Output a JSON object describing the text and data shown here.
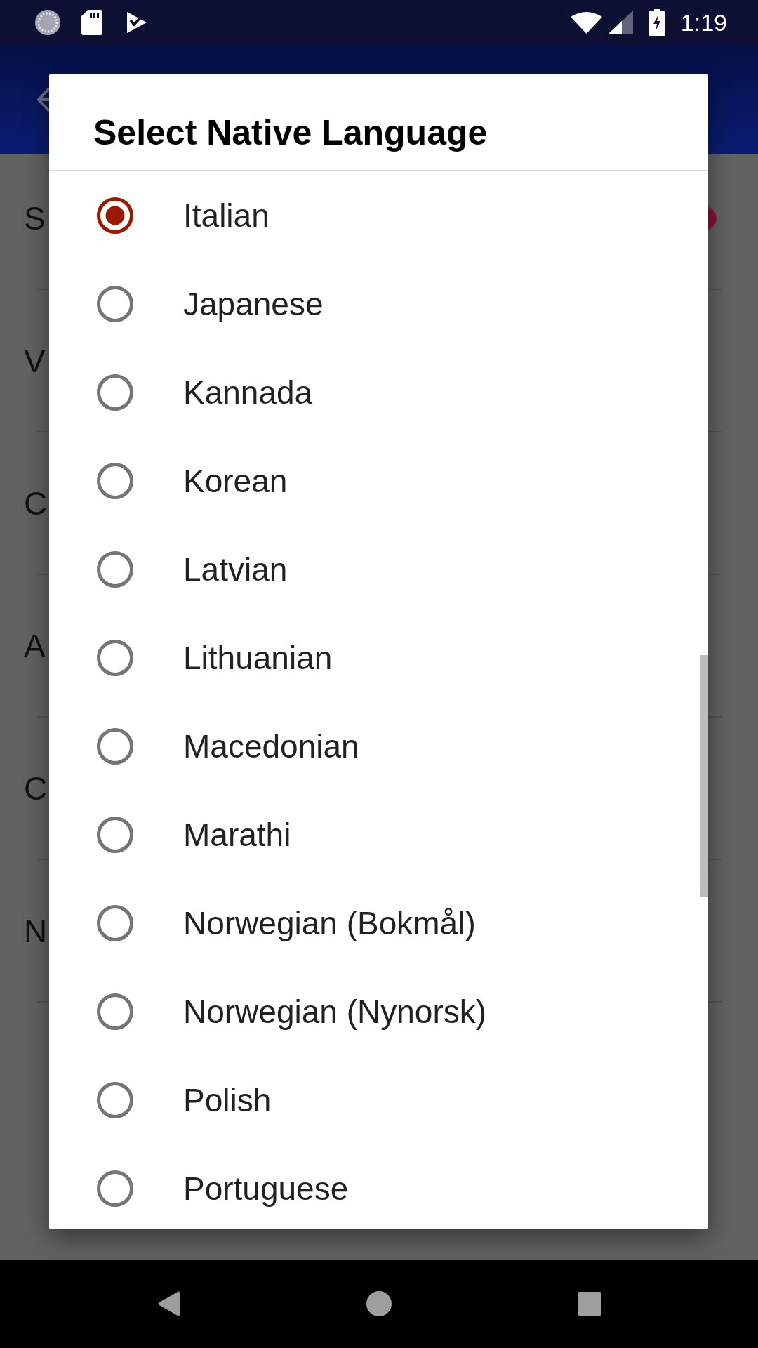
{
  "status_bar": {
    "time": "1:19"
  },
  "background": {
    "rows": [
      {
        "text": "S",
        "badge": true
      },
      {
        "text": "V",
        "badge": false
      },
      {
        "text": "C",
        "badge": false
      },
      {
        "text": "A",
        "badge": false
      },
      {
        "text": "C",
        "badge": false
      },
      {
        "text": "N",
        "badge": false
      }
    ]
  },
  "dialog": {
    "title": "Select Native Language",
    "options": [
      {
        "label": "Italian",
        "selected": true
      },
      {
        "label": "Japanese",
        "selected": false
      },
      {
        "label": "Kannada",
        "selected": false
      },
      {
        "label": "Korean",
        "selected": false
      },
      {
        "label": "Latvian",
        "selected": false
      },
      {
        "label": "Lithuanian",
        "selected": false
      },
      {
        "label": "Macedonian",
        "selected": false
      },
      {
        "label": "Marathi",
        "selected": false
      },
      {
        "label": "Norwegian (Bokmål)",
        "selected": false
      },
      {
        "label": "Norwegian (Nynorsk)",
        "selected": false
      },
      {
        "label": "Polish",
        "selected": false
      },
      {
        "label": "Portuguese",
        "selected": false
      }
    ]
  }
}
